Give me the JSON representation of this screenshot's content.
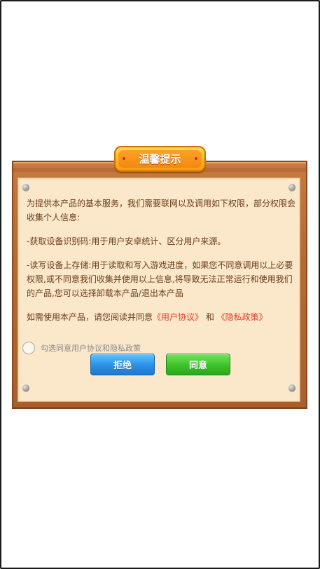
{
  "dialog": {
    "title": "温馨提示",
    "paragraphs": {
      "intro": "为提供本产品的基本服务，我们需要联网以及调用如下权限，部分权限会收集个人信息:",
      "device_id": "-获取设备识别码:用于用户安卓统计、区分用户来源。",
      "storage": "-读写设备上存储:用于读取和写入游戏进度，如果您不同意调用以上必要权限,或不同意我们收集并使用以上信息,将导致无法正常运行和使用我们的产品,您可以选择卸载本产品/退出本产品"
    },
    "consent": {
      "prefix": "如需使用本产品，请您阅读并同意",
      "user_agreement_link": "《用户协议》",
      "conjunction": " 和 ",
      "privacy_policy_link": "《隐私政策》"
    },
    "checkbox_label": "勾选同意用户协议和隐私政策",
    "buttons": {
      "reject": "拒绝",
      "agree": "同意"
    }
  },
  "colors": {
    "wood": "#b46a32",
    "paper": "#fbe7c9",
    "text": "#6a3c1a",
    "link": "#e8402a",
    "title_tab": "#ffb21e",
    "reject_button": "#2a8fe6",
    "agree_button": "#3cc22a"
  },
  "icons": {
    "checkbox": "radio-circle-icon",
    "rivets": "rivet-icon"
  }
}
